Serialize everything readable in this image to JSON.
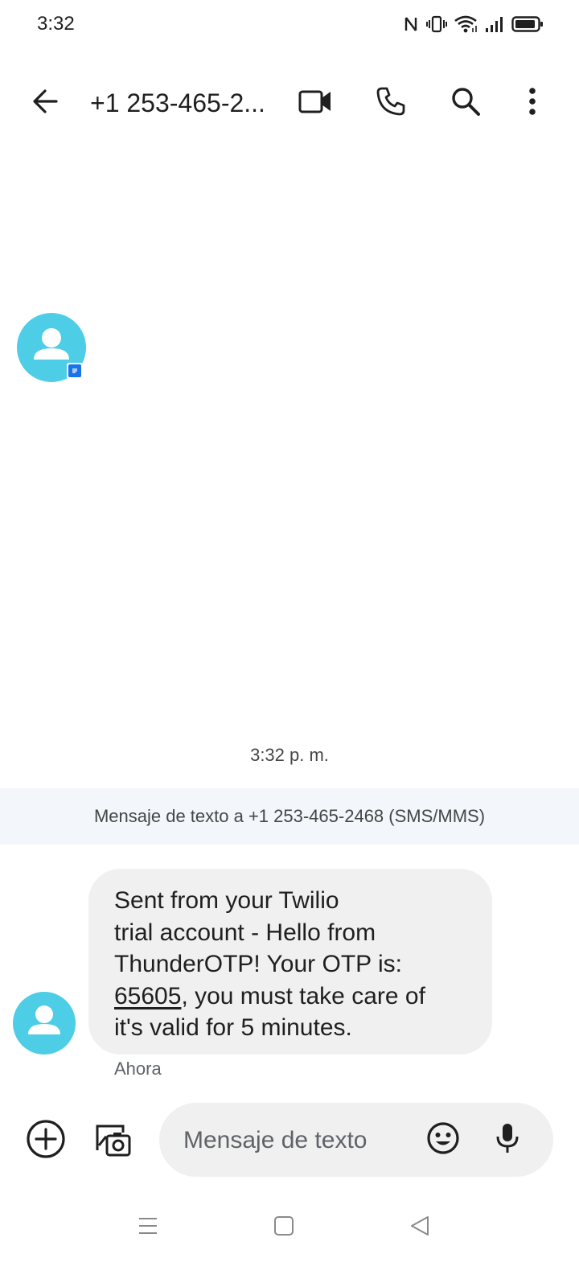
{
  "status_bar": {
    "time": "3:32",
    "icons": [
      "nfc-icon",
      "vibrate-icon",
      "wifi-icon",
      "signal-icon",
      "battery-icon"
    ]
  },
  "app_bar": {
    "title": "+1 253-465-2...",
    "icons": [
      "back-arrow-icon",
      "video-call-icon",
      "phone-icon",
      "search-icon",
      "more-vert-icon"
    ]
  },
  "conversation": {
    "timestamp": "3:32 p. m.",
    "info_banner": "Mensaje de texto a +1 253-465-2468 (SMS/MMS)",
    "message": {
      "lines": [
        "Sent from your Twilio",
        "trial account - Hello from",
        "ThunderOTP! Your OTP is:"
      ],
      "otp_code": "65605",
      "line4_rest": ", you must take care of",
      "line5": "it's valid for 5 minutes.",
      "time": "Ahora"
    }
  },
  "compose": {
    "placeholder": "Mensaje de texto",
    "icons": [
      "add-icon",
      "gallery-icon",
      "emoji-icon",
      "mic-icon"
    ]
  },
  "nav_bar": {
    "icons": [
      "menu-icon",
      "home-icon",
      "back-icon"
    ]
  },
  "colors": {
    "avatar": "#4ecde6",
    "bubble": "#f0f0f0",
    "banner": "#f3f6fb",
    "rcs_badge": "#1a73e8"
  }
}
